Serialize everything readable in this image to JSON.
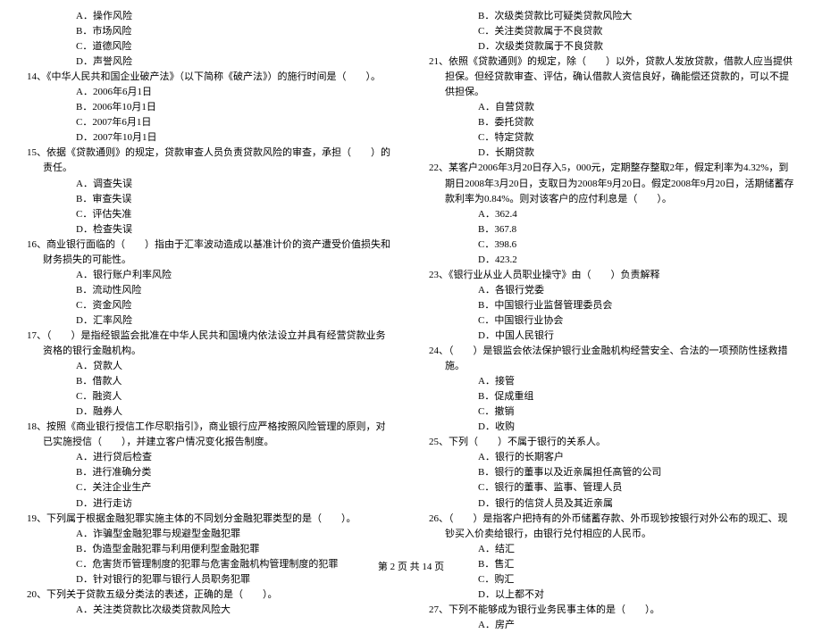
{
  "left": {
    "q13_opts": [
      "A．操作风险",
      "B．市场风险",
      "C．道德风险",
      "D．声誉风险"
    ],
    "q14": "14、《中华人民共和国企业破产法》（以下简称《破产法》）的施行时间是（　　）。",
    "q14_opts": [
      "A．2006年6月1日",
      "B．2006年10月1日",
      "C．2007年6月1日",
      "D．2007年10月1日"
    ],
    "q15": "15、依据《贷款通则》的规定，贷款审查人员负责贷款风险的审查，承担（　　）的责任。",
    "q15_opts": [
      "A．调查失误",
      "B．审查失误",
      "C．评估失准",
      "D．检查失误"
    ],
    "q16": "16、商业银行面临的（　　）指由于汇率波动造成以基准计价的资产遭受价值损失和财务损失的可能性。",
    "q16_opts": [
      "A．银行账户利率风险",
      "B．流动性风险",
      "C．资金风险",
      "D．汇率风险"
    ],
    "q17": "17、（　　）是指经银监会批准在中华人民共和国境内依法设立并具有经营贷款业务资格的银行金融机构。",
    "q17_opts": [
      "A．贷款人",
      "B．借款人",
      "C．融资人",
      "D．融券人"
    ],
    "q18": "18、按照《商业银行授信工作尽职指引》，商业银行应严格按照风险管理的原则，对已实施授信（　　），并建立客户情况变化报告制度。",
    "q18_opts": [
      "A．进行贷后检查",
      "B．进行准确分类",
      "C．关注企业生产",
      "D．进行走访"
    ],
    "q19": "19、下列属于根据金融犯罪实施主体的不同划分金融犯罪类型的是（　　）。",
    "q19_opts": [
      "A．诈骗型金融犯罪与规避型金融犯罪",
      "B．伪造型金融犯罪与利用便利型金融犯罪",
      "C．危害货币管理制度的犯罪与危害金融机构管理制度的犯罪",
      "D．针对银行的犯罪与银行人员职务犯罪"
    ],
    "q20": "20、下列关于贷款五级分类法的表述，正确的是（　　）。",
    "q20_opts": [
      "A．关注类贷款比次级类贷款风险大"
    ]
  },
  "right": {
    "q20_opts_cont": [
      "B．次级类贷款比可疑类贷款风险大",
      "C．关注类贷款属于不良贷款",
      "D．次级类贷款属于不良贷款"
    ],
    "q21": "21、依照《贷款通则》的规定，除（　　）以外，贷款人发放贷款，借款人应当提供担保。但经贷款审查、评估，确认借款人资信良好，确能偿还贷款的，可以不提供担保。",
    "q21_opts": [
      "A．自营贷款",
      "B．委托贷款",
      "C．特定贷款",
      "D．长期贷款"
    ],
    "q22": "22、某客户2006年3月20日存入5，000元，定期整存整取2年，假定利率为4.32%，到期日2008年3月20日，支取日为2008年9月20日。假定2008年9月20日，活期储蓄存款利率为0.84%。则对该客户的应付利息是（　　）。",
    "q22_opts": [
      "A．362.4",
      "B．367.8",
      "C．398.6",
      "D．423.2"
    ],
    "q23": "23、《银行业从业人员职业操守》由（　　）负责解释",
    "q23_opts": [
      "A．各银行党委",
      "B．中国银行业监督管理委员会",
      "C．中国银行业协会",
      "D．中国人民银行"
    ],
    "q24": "24、（　　）是银监会依法保护银行业金融机构经营安全、合法的一项预防性拯救措施。",
    "q24_opts": [
      "A．接管",
      "B．促成重组",
      "C．撤销",
      "D．收购"
    ],
    "q25": "25、下列（　　）不属于银行的关系人。",
    "q25_opts": [
      "A．银行的长期客户",
      "B．银行的董事以及近亲属担任高管的公司",
      "C．银行的董事、监事、管理人员",
      "D．银行的信贷人员及其近亲属"
    ],
    "q26": "26、（　　）是指客户把持有的外币储蓄存款、外币现钞按银行对外公布的现汇、现钞买入价卖给银行，由银行兑付相应的人民币。",
    "q26_opts": [
      "A．结汇",
      "B．售汇",
      "C．购汇",
      "D．以上都不对"
    ],
    "q27": "27、下列不能够成为银行业务民事主体的是（　　）。",
    "q27_opts": [
      "A．房产"
    ]
  },
  "footer": "第 2 页 共 14 页"
}
